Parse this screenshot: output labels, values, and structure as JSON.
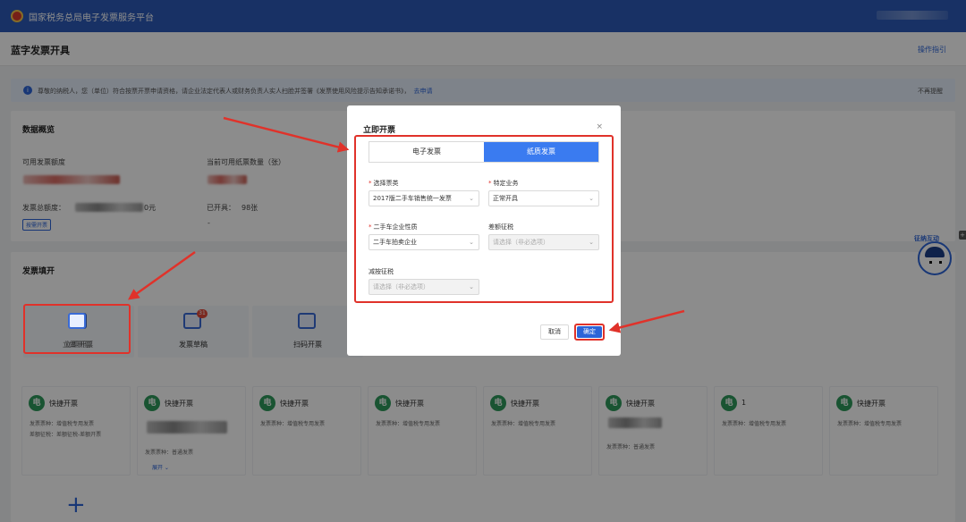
{
  "header": {
    "title": "国家税务总局电子发票服务平台"
  },
  "page": {
    "title": "蓝字发票开具",
    "guide_link": "操作指引"
  },
  "notice": {
    "text": "尊敬的纳税人，您（单位）符合按票开票申请资格，请企业法定代表人或财务负责人实人扫脸并签署《发票使用风险提示告知承诺书》，",
    "link": "去申请",
    "dismiss": "不再提醒"
  },
  "overview": {
    "title": "数据概览",
    "available_quota_label": "可用发票额度",
    "available_paper_label": "当前可用纸票数量（张）",
    "total_quota_label": "发票总额度：",
    "total_quota_suffix": "0元",
    "issued_label": "已开具：",
    "issued_value": "98张",
    "dash": "-",
    "quota_button": "按需开票"
  },
  "invoice_fill": {
    "title": "发票填开",
    "tiles": [
      {
        "label": "立即开票"
      },
      {
        "label": "发票草稿",
        "badge": "31"
      },
      {
        "label": "扫码开票"
      }
    ],
    "templates": [
      {
        "name": "快捷开票",
        "lines": [
          "发票票种：增值税专用发票",
          "差额征税：差额征税-差额开票"
        ]
      },
      {
        "name": "快捷开票",
        "lines": [
          "发票票种：普通发票"
        ],
        "expand": "展开 ⌄"
      },
      {
        "name": "快捷开票",
        "lines": [
          "发票票种：增值税专用发票"
        ]
      },
      {
        "name": "快捷开票",
        "lines": [
          "发票票种：增值税专用发票"
        ]
      },
      {
        "name": "快捷开票",
        "lines": [
          "发票票种：增值税专用发票"
        ]
      },
      {
        "name": "快捷开票",
        "lines": [
          "发票票种：普通发票"
        ]
      },
      {
        "name": "1",
        "lines": [
          "发票票种：增值税专用发票"
        ]
      },
      {
        "name": "快捷开票",
        "lines": [
          "发票票种：增值税专用发票"
        ]
      }
    ],
    "e_icon": "电",
    "plus": "+"
  },
  "assistant": {
    "label": "征纳互动"
  },
  "modal": {
    "title": "立即开票",
    "close": "×",
    "tabs": [
      {
        "label": "电子发票",
        "active": false
      },
      {
        "label": "纸质发票",
        "active": true
      }
    ],
    "fields": {
      "ticket_type": {
        "label": "选择票类",
        "value": "2017版二手车销售统一发票"
      },
      "special_business": {
        "label": "特定业务",
        "value": "正常开具"
      },
      "used_car_nature": {
        "label": "二手车企业性质",
        "value": "二手车拍卖企业"
      },
      "diff_tax": {
        "label": "差额征税",
        "placeholder": "请选择（非必选项）"
      },
      "reduce_tax": {
        "label": "减按征税",
        "placeholder": "请选择（非必选项）"
      }
    },
    "cancel": "取消",
    "confirm": "确定"
  },
  "colors": {
    "primary": "#2c64d8",
    "header": "#2c5ab8",
    "highlight": "#e0322a",
    "e_icon": "#2f9a5b"
  }
}
